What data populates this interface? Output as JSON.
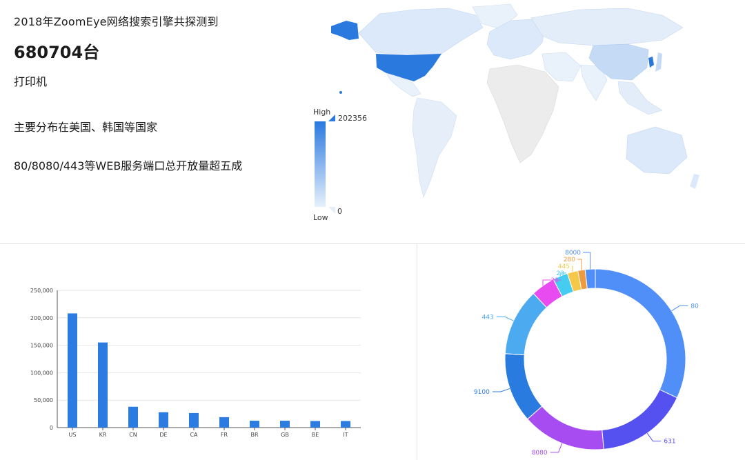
{
  "summary": {
    "line1": "2018年ZoomEye网络搜索引擎共探测到",
    "count": "680704台",
    "device": "打印机",
    "distribution": "主要分布在美国、韩国等国家",
    "ports": "80/8080/443等WEB服务端口总开放量超五成"
  },
  "map_legend": {
    "high_label": "High",
    "low_label": "Low",
    "max_value": "202356",
    "min_value": "0"
  },
  "chart_data": [
    {
      "type": "bar",
      "categories": [
        "US",
        "KR",
        "CN",
        "DE",
        "CA",
        "FR",
        "BR",
        "GB",
        "BE",
        "IT"
      ],
      "values": [
        208000,
        155000,
        38000,
        28000,
        26500,
        19000,
        12500,
        12500,
        12000,
        12000
      ],
      "ylim": [
        0,
        250000
      ],
      "yticks": [
        "0",
        "50,000",
        "100,000",
        "150,000",
        "200,000",
        "250,000"
      ],
      "grid": true,
      "color": "#2b7be0"
    },
    {
      "type": "pie",
      "donut": true,
      "labels": [
        "80",
        "631",
        "8080",
        "9100",
        "443",
        "21",
        "23",
        "445",
        "280",
        "8000"
      ],
      "values": [
        32.0,
        16.5,
        15.0,
        12.5,
        12.0,
        4.3,
        2.7,
        1.9,
        1.3,
        1.8
      ],
      "colors": [
        "#4f8ff7",
        "#5550f0",
        "#a64cf0",
        "#2a7be0",
        "#4caaf0",
        "#e84cf0",
        "#44cdf0",
        "#f5c84a",
        "#f09a40",
        "#4f8ff7"
      ]
    }
  ]
}
